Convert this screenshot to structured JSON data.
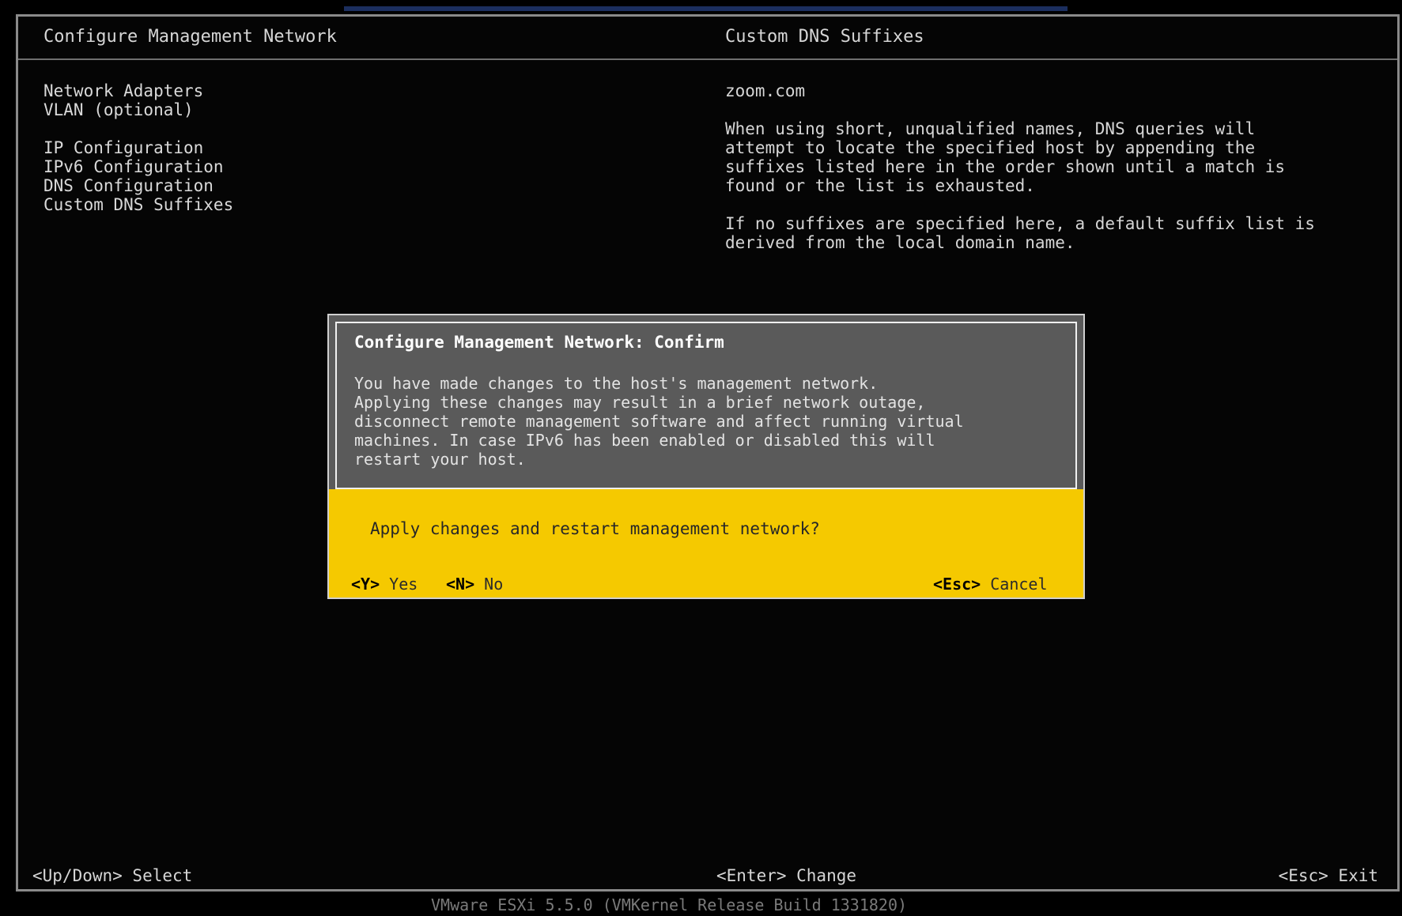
{
  "header": {
    "left_title": "Configure Management Network",
    "right_title": "Custom DNS Suffixes"
  },
  "menu": {
    "items": [
      "Network Adapters",
      "VLAN (optional)",
      "IP Configuration",
      "IPv6 Configuration",
      "DNS Configuration",
      "Custom DNS Suffixes"
    ]
  },
  "panel": {
    "domain": "zoom.com",
    "paragraph1": [
      "When using short, unqualified names, DNS queries will",
      "attempt to locate the specified host by appending the",
      "suffixes listed here in the order shown until a match is",
      "found or the list is exhausted."
    ],
    "paragraph2": [
      "If no suffixes are specified here, a default suffix list is",
      "derived from the local domain name."
    ]
  },
  "dialog": {
    "title": "Configure Management Network: Confirm",
    "message": [
      "You have made changes to the host's management network.",
      "Applying these changes may result in a brief network outage,",
      "disconnect remote management software and affect running virtual",
      "machines. In case IPv6 has been enabled or disabled this will",
      "restart your host."
    ],
    "question": "Apply changes and restart management network?",
    "yes": {
      "key": "<Y>",
      "label": "Yes"
    },
    "no": {
      "key": "<N>",
      "label": "No"
    },
    "cancel": {
      "key": "<Esc>",
      "label": "Cancel"
    }
  },
  "footer": {
    "left": "<Up/Down> Select",
    "center": "<Enter> Change",
    "right": "<Esc> Exit"
  },
  "build": "VMware ESXi 5.5.0 (VMKernel Release Build 1331820)",
  "colors": {
    "background": "#000000",
    "dialog_gray": "#5a5a5a",
    "dialog_yellow": "#f5c900",
    "text": "#d6d6d6"
  }
}
